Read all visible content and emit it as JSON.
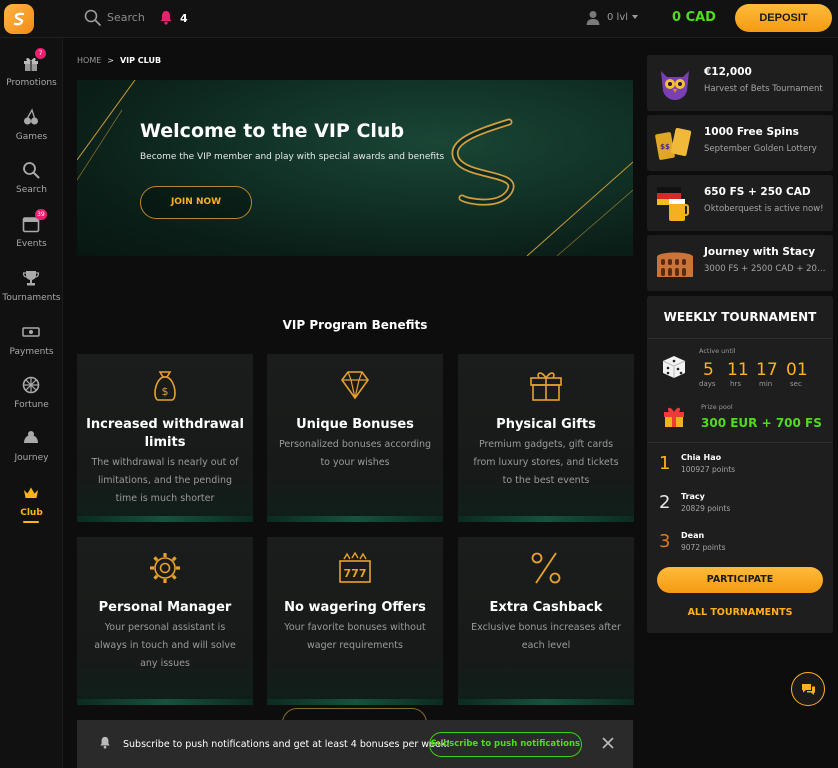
{
  "header": {
    "search_label": "Search",
    "notifications_count": "4",
    "user_level": "0 lvl",
    "balance": "0 CAD",
    "deposit_label": "DEPOSIT"
  },
  "sidebar": {
    "items": [
      {
        "label": "Promotions",
        "icon": "gift-icon",
        "badge": "7"
      },
      {
        "label": "Games",
        "icon": "cherries-icon"
      },
      {
        "label": "Search",
        "icon": "search-icon"
      },
      {
        "label": "Events",
        "icon": "calendar-icon",
        "badge": "39"
      },
      {
        "label": "Tournaments",
        "icon": "trophy-icon"
      },
      {
        "label": "Payments",
        "icon": "cash-icon"
      },
      {
        "label": "Fortune",
        "icon": "wheel-icon"
      },
      {
        "label": "Journey",
        "icon": "map-icon"
      },
      {
        "label": "Club",
        "icon": "crown-icon",
        "active": true
      }
    ]
  },
  "breadcrumb": {
    "home": "HOME",
    "separator": ">",
    "current": "VIP CLUB"
  },
  "hero": {
    "title": "Welcome to the VIP Club",
    "subtitle": "Become the VIP member and play with special awards and benefits",
    "join_label": "JOIN NOW"
  },
  "benefits": {
    "title": "VIP Program Benefits",
    "cards": [
      {
        "title": "Increased withdrawal limits",
        "desc": "The withdrawal is nearly out of limitations, and the pending time is much shorter",
        "icon": "money-bag-icon"
      },
      {
        "title": "Unique Bonuses",
        "desc": "Personalized bonuses according to your wishes",
        "icon": "diamond-icon"
      },
      {
        "title": "Physical Gifts",
        "desc": "Premium gadgets, gift cards from luxury stores, and tickets to the best events",
        "icon": "gift-box-icon"
      },
      {
        "title": "Personal Manager",
        "desc": "Your personal assistant is always in touch and will solve any issues",
        "icon": "gear-icon"
      },
      {
        "title": "No wagering Offers",
        "desc": "Your favorite bonuses without wager requirements",
        "icon": "slot-777-icon"
      },
      {
        "title": "Extra Cashback",
        "desc": "Exclusive bonus increases after each level",
        "icon": "percent-icon"
      }
    ]
  },
  "push": {
    "text": "Subscribe to push notifications and get at least 4 bonuses per week!",
    "subscribe_label": "Subscribe to push notifications"
  },
  "promos": [
    {
      "title": "€12,000",
      "subtitle": "Harvest of Bets Tournament",
      "icon": "owl-icon"
    },
    {
      "title": "1000 Free Spins",
      "subtitle": "September Golden Lottery",
      "icon": "tickets-icon"
    },
    {
      "title": "650 FS + 250 CAD",
      "subtitle": "Oktoberquest is active now!",
      "icon": "oktoberfest-icon"
    },
    {
      "title": "Journey with Stacy",
      "subtitle": "3000 FS + 2500 CAD + 200 FS",
      "icon": "colosseum-icon"
    }
  ],
  "weekly": {
    "title": "WEEKLY TOURNAMENT",
    "active_until_label": "Active until",
    "countdown": [
      {
        "value": "5",
        "unit": "days"
      },
      {
        "value": "11",
        "unit": "hrs"
      },
      {
        "value": "17",
        "unit": "min"
      },
      {
        "value": "01",
        "unit": "sec"
      }
    ],
    "prize_label": "Prize pool",
    "prize": "300 EUR + 700 FS",
    "leaders": [
      {
        "rank": "1",
        "name": "Chia Hao",
        "points": "100927 points"
      },
      {
        "rank": "2",
        "name": "Tracy",
        "points": "20829 points"
      },
      {
        "rank": "3",
        "name": "Dean",
        "points": "9072 points"
      }
    ],
    "participate_label": "PARTICIPATE",
    "all_label": "ALL TOURNAMENTS"
  },
  "colors": {
    "accent": "#ffb21c",
    "balance_green": "#4fdc1e",
    "badge_pink": "#e8206e",
    "hero_green": "#123428"
  }
}
